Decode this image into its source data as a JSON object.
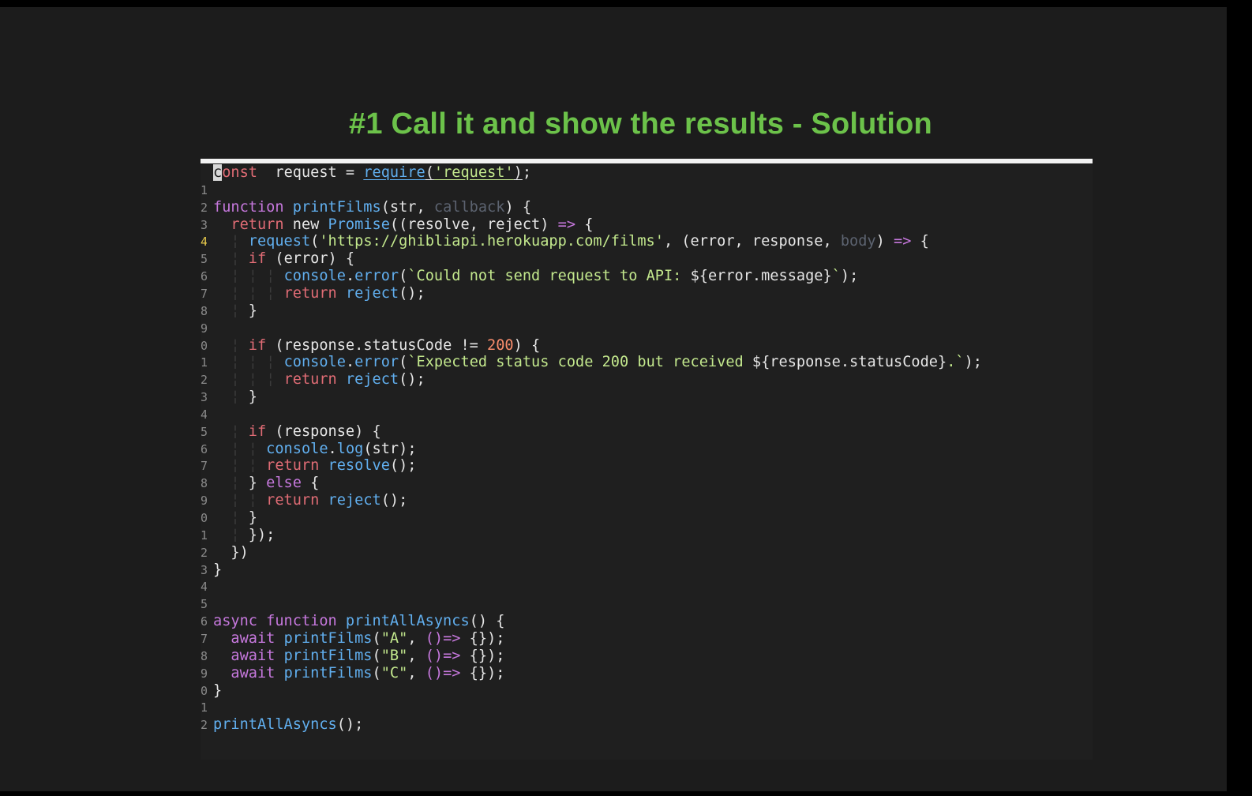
{
  "slide": {
    "title": "#1 Call it and show the results - Solution"
  },
  "editor": {
    "gutter": [
      "",
      "1",
      "2",
      "3",
      "4",
      "5",
      "6",
      "7",
      "8",
      "9",
      "0",
      "1",
      "2",
      "3",
      "4",
      "5",
      "6",
      "7",
      "8",
      "9",
      "0",
      "1",
      "2",
      "3",
      "4",
      "5",
      "6",
      "7",
      "8",
      "9",
      "0",
      "1",
      "2"
    ],
    "lines": [
      [
        [
          "cursor",
          "c"
        ],
        [
          "kw",
          "onst"
        ],
        [
          "",
          "  request = "
        ],
        [
          "fn ul",
          "require"
        ],
        [
          "ul",
          "("
        ],
        [
          "st ul",
          "'request'"
        ],
        [
          "ul",
          ")"
        ],
        [
          "",
          ";"
        ]
      ],
      [],
      [
        [
          "dc",
          "function "
        ],
        [
          "fn",
          "printFilms"
        ],
        [
          "",
          "(str, "
        ],
        [
          "dim",
          "callback"
        ],
        [
          "",
          ") {"
        ]
      ],
      [
        [
          "",
          "  "
        ],
        [
          "kw",
          "return "
        ],
        [
          "",
          "new "
        ],
        [
          "fn",
          "Promise"
        ],
        [
          "",
          "((resolve, reject) "
        ],
        [
          "dc",
          "=>"
        ],
        [
          "",
          " {"
        ]
      ],
      [
        [
          "",
          "  "
        ],
        [
          "ig",
          "¦ "
        ],
        [
          "fn",
          "request"
        ],
        [
          "",
          "("
        ],
        [
          "st",
          "'https://ghibliapi.herokuapp.com/films'"
        ],
        [
          "",
          ", (error, response, "
        ],
        [
          "dim",
          "body"
        ],
        [
          "",
          ") "
        ],
        [
          "dc",
          "=>"
        ],
        [
          "",
          " {"
        ]
      ],
      [
        [
          "",
          "  "
        ],
        [
          "ig",
          "¦ "
        ],
        [
          "kw",
          "if "
        ],
        [
          "",
          "(error) {"
        ]
      ],
      [
        [
          "",
          "  "
        ],
        [
          "ig",
          "¦ ¦ ¦ "
        ],
        [
          "fn",
          "console"
        ],
        [
          "",
          "."
        ],
        [
          "fn",
          "error"
        ],
        [
          "",
          "("
        ],
        [
          "st",
          "`Could not send request to API: "
        ],
        [
          "",
          "${error.message}"
        ],
        [
          "st",
          "`"
        ],
        [
          "",
          ");"
        ]
      ],
      [
        [
          "",
          "  "
        ],
        [
          "ig",
          "¦ ¦ ¦ "
        ],
        [
          "kw",
          "return "
        ],
        [
          "fn",
          "reject"
        ],
        [
          "",
          "();"
        ]
      ],
      [
        [
          "",
          "  "
        ],
        [
          "ig",
          "¦ "
        ],
        [
          "",
          "}"
        ]
      ],
      [],
      [
        [
          "",
          "  "
        ],
        [
          "ig",
          "¦ "
        ],
        [
          "kw",
          "if "
        ],
        [
          "",
          "(response.statusCode != "
        ],
        [
          "nu",
          "200"
        ],
        [
          "",
          ") {"
        ]
      ],
      [
        [
          "",
          "  "
        ],
        [
          "ig",
          "¦ ¦ ¦ "
        ],
        [
          "fn",
          "console"
        ],
        [
          "",
          "."
        ],
        [
          "fn",
          "error"
        ],
        [
          "",
          "("
        ],
        [
          "st",
          "`Expected status code 200 but received "
        ],
        [
          "",
          "${response.statusCode}"
        ],
        [
          "st",
          ".`"
        ],
        [
          "",
          ");"
        ]
      ],
      [
        [
          "",
          "  "
        ],
        [
          "ig",
          "¦ ¦ ¦ "
        ],
        [
          "kw",
          "return "
        ],
        [
          "fn",
          "reject"
        ],
        [
          "",
          "();"
        ]
      ],
      [
        [
          "",
          "  "
        ],
        [
          "ig",
          "¦ "
        ],
        [
          "",
          "}"
        ]
      ],
      [],
      [
        [
          "",
          "  "
        ],
        [
          "ig",
          "¦ "
        ],
        [
          "kw",
          "if "
        ],
        [
          "",
          "(response) {"
        ]
      ],
      [
        [
          "",
          "  "
        ],
        [
          "ig",
          "¦ ¦ "
        ],
        [
          "fn",
          "console"
        ],
        [
          "",
          "."
        ],
        [
          "fn",
          "log"
        ],
        [
          "",
          "(str);"
        ]
      ],
      [
        [
          "",
          "  "
        ],
        [
          "ig",
          "¦ ¦ "
        ],
        [
          "kw",
          "return "
        ],
        [
          "fn",
          "resolve"
        ],
        [
          "",
          "();"
        ]
      ],
      [
        [
          "",
          "  "
        ],
        [
          "ig",
          "¦ "
        ],
        [
          "",
          "} "
        ],
        [
          "dc",
          "else "
        ],
        [
          "",
          "{"
        ]
      ],
      [
        [
          "",
          "  "
        ],
        [
          "ig",
          "¦ ¦ "
        ],
        [
          "kw",
          "return "
        ],
        [
          "fn",
          "reject"
        ],
        [
          "",
          "();"
        ]
      ],
      [
        [
          "",
          "  "
        ],
        [
          "ig",
          "¦ "
        ],
        [
          "",
          "}"
        ]
      ],
      [
        [
          "",
          "  "
        ],
        [
          "ig",
          "¦ "
        ],
        [
          "",
          "});"
        ]
      ],
      [
        [
          "",
          "  })"
        ]
      ],
      [
        [
          "",
          "}"
        ]
      ],
      [],
      [],
      [
        [
          "dc",
          "async function "
        ],
        [
          "fn",
          "printAllAsyncs"
        ],
        [
          "",
          "() {"
        ]
      ],
      [
        [
          "",
          "  "
        ],
        [
          "dc",
          "await "
        ],
        [
          "fn",
          "printFilms"
        ],
        [
          "",
          "("
        ],
        [
          "st",
          "\"A\""
        ],
        [
          "",
          ", "
        ],
        [
          "dc",
          "()=>"
        ],
        [
          "",
          " {});"
        ]
      ],
      [
        [
          "",
          "  "
        ],
        [
          "dc",
          "await "
        ],
        [
          "fn",
          "printFilms"
        ],
        [
          "",
          "("
        ],
        [
          "st",
          "\"B\""
        ],
        [
          "",
          ", "
        ],
        [
          "dc",
          "()=>"
        ],
        [
          "",
          " {});"
        ]
      ],
      [
        [
          "",
          "  "
        ],
        [
          "dc",
          "await "
        ],
        [
          "fn",
          "printFilms"
        ],
        [
          "",
          "("
        ],
        [
          "st",
          "\"C\""
        ],
        [
          "",
          ", "
        ],
        [
          "dc",
          "()=>"
        ],
        [
          "",
          " {});"
        ]
      ],
      [
        [
          "",
          "}"
        ]
      ],
      [],
      [
        [
          "fn",
          "printAllAsyncs"
        ],
        [
          "",
          "();"
        ]
      ]
    ]
  }
}
